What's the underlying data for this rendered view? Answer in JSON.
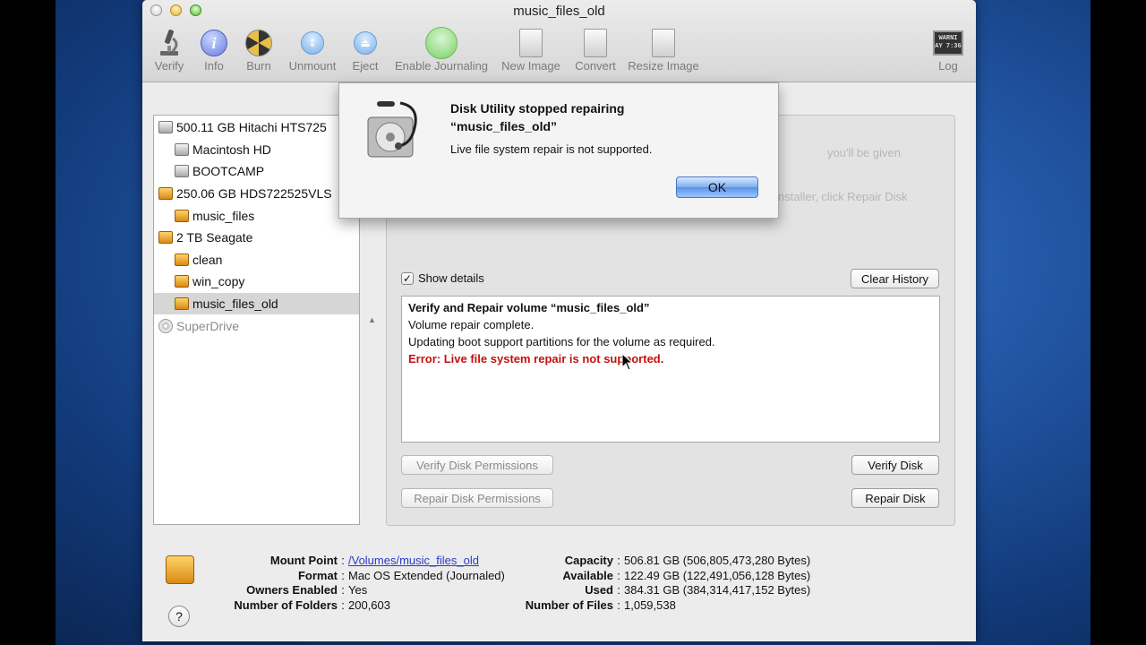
{
  "window": {
    "title": "music_files_old"
  },
  "toolbar": {
    "verify": "Verify",
    "info": "Info",
    "burn": "Burn",
    "unmount": "Unmount",
    "eject": "Eject",
    "enable_journaling": "Enable Journaling",
    "new_image": "New Image",
    "convert": "Convert",
    "resize_image": "Resize Image",
    "log": "Log",
    "log_icon_text_1": "WARNI",
    "log_icon_text_2": "AY 7:36"
  },
  "sidebar": {
    "items": [
      {
        "label": "500.11 GB Hitachi HTS725",
        "icon": "internal-drive-icon"
      },
      {
        "label": "Macintosh HD",
        "icon": "volume-icon"
      },
      {
        "label": "BOOTCAMP",
        "icon": "volume-icon"
      },
      {
        "label": "250.06 GB HDS722525VLS",
        "icon": "external-drive-icon"
      },
      {
        "label": "music_files",
        "icon": "external-volume-icon"
      },
      {
        "label": "2 TB Seagate",
        "icon": "external-drive-icon"
      },
      {
        "label": "clean",
        "icon": "external-volume-icon"
      },
      {
        "label": "win_copy",
        "icon": "external-volume-icon"
      },
      {
        "label": "music_files_old",
        "icon": "external-volume-icon"
      },
      {
        "label": "SuperDrive",
        "icon": "optical-drive-icon"
      }
    ]
  },
  "pane": {
    "bg_text_1": "you'll be given",
    "bg_text_2": "nstaller, click Repair Disk",
    "show_details_label": "Show details",
    "clear_history": "Clear History",
    "verify_permissions": "Verify Disk Permissions",
    "repair_permissions": "Repair Disk Permissions",
    "verify_disk": "Verify Disk",
    "repair_disk": "Repair Disk"
  },
  "log": {
    "line1": "Verify and Repair volume “music_files_old”",
    "line2": "Volume repair complete.",
    "line3": "Updating boot support partitions for the volume as required.",
    "line4": "Error: Live file system repair is not supported."
  },
  "sheet": {
    "title_line1": "Disk Utility stopped repairing",
    "title_line2": "“music_files_old”",
    "message": "Live file system repair is not supported.",
    "ok": "OK"
  },
  "info": {
    "left": [
      {
        "key": "Mount Point",
        "value": "/Volumes/music_files_old"
      },
      {
        "key": "Format",
        "value": "Mac OS Extended (Journaled)"
      },
      {
        "key": "Owners Enabled",
        "value": "Yes"
      },
      {
        "key": "Number of Folders",
        "value": "200,603"
      }
    ],
    "right": [
      {
        "key": "Capacity",
        "value": "506.81 GB (506,805,473,280 Bytes)"
      },
      {
        "key": "Available",
        "value": "122.49 GB (122,491,056,128 Bytes)"
      },
      {
        "key": "Used",
        "value": "384.31 GB (384,314,417,152 Bytes)"
      },
      {
        "key": "Number of Files",
        "value": "1,059,538"
      }
    ],
    "help": "?"
  }
}
